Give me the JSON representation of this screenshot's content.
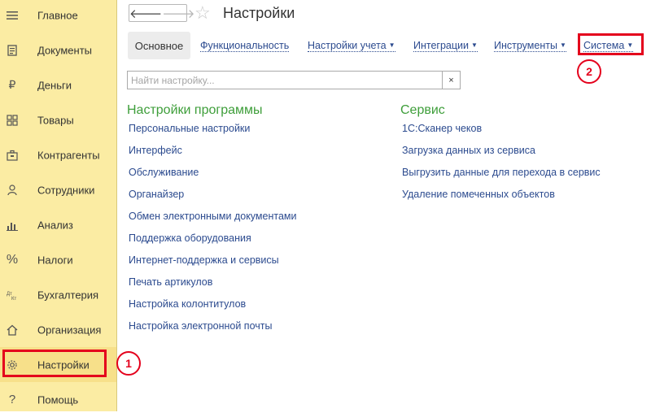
{
  "sidebar": {
    "items": [
      {
        "label": "Главное",
        "icon": "menu-icon"
      },
      {
        "label": "Документы",
        "icon": "documents-icon"
      },
      {
        "label": "Деньги",
        "icon": "ruble-icon"
      },
      {
        "label": "Товары",
        "icon": "goods-icon"
      },
      {
        "label": "Контрагенты",
        "icon": "contractors-icon"
      },
      {
        "label": "Сотрудники",
        "icon": "person-icon"
      },
      {
        "label": "Анализ",
        "icon": "chart-icon"
      },
      {
        "label": "Налоги",
        "icon": "percent-icon"
      },
      {
        "label": "Бухгалтерия",
        "icon": "accounting-icon"
      },
      {
        "label": "Организация",
        "icon": "home-icon"
      },
      {
        "label": "Настройки",
        "icon": "gear-icon"
      },
      {
        "label": "Помощь",
        "icon": "help-icon"
      }
    ],
    "active_index": 10
  },
  "header": {
    "title": "Настройки",
    "back_glyph": "🡐",
    "forward_glyph": "🡒",
    "star_glyph": "☆"
  },
  "tabs": {
    "active": "Основное",
    "links": [
      {
        "label": "Функциональность",
        "has_dropdown": false
      },
      {
        "label": "Настройки учета",
        "has_dropdown": true
      },
      {
        "label": "Интеграции",
        "has_dropdown": true
      },
      {
        "label": "Инструменты",
        "has_dropdown": true
      },
      {
        "label": "Система",
        "has_dropdown": true
      }
    ],
    "caret": "▼"
  },
  "search": {
    "placeholder": "Найти настройку...",
    "value": "",
    "clear_glyph": "×"
  },
  "sections": {
    "program": {
      "title": "Настройки программы",
      "links": [
        "Персональные настройки",
        "Интерфейс",
        "Обслуживание",
        "Органайзер",
        "Обмен электронными документами",
        "Поддержка оборудования",
        "Интернет-поддержка и сервисы",
        "Печать артикулов",
        "Настройка колонтитулов",
        "Настройка электронной почты"
      ]
    },
    "service": {
      "title": "Сервис",
      "links": [
        "1С:Сканер чеков",
        "Загрузка данных из сервиса",
        "Выгрузить данные для перехода в сервис",
        "Удаление помеченных объектов"
      ]
    }
  },
  "callouts": [
    "1",
    "2"
  ],
  "colors": {
    "sidebar_bg": "#fbeca3",
    "link": "#2c4b8f",
    "section_title": "#3e9e3a",
    "highlight": "#e4001c"
  }
}
